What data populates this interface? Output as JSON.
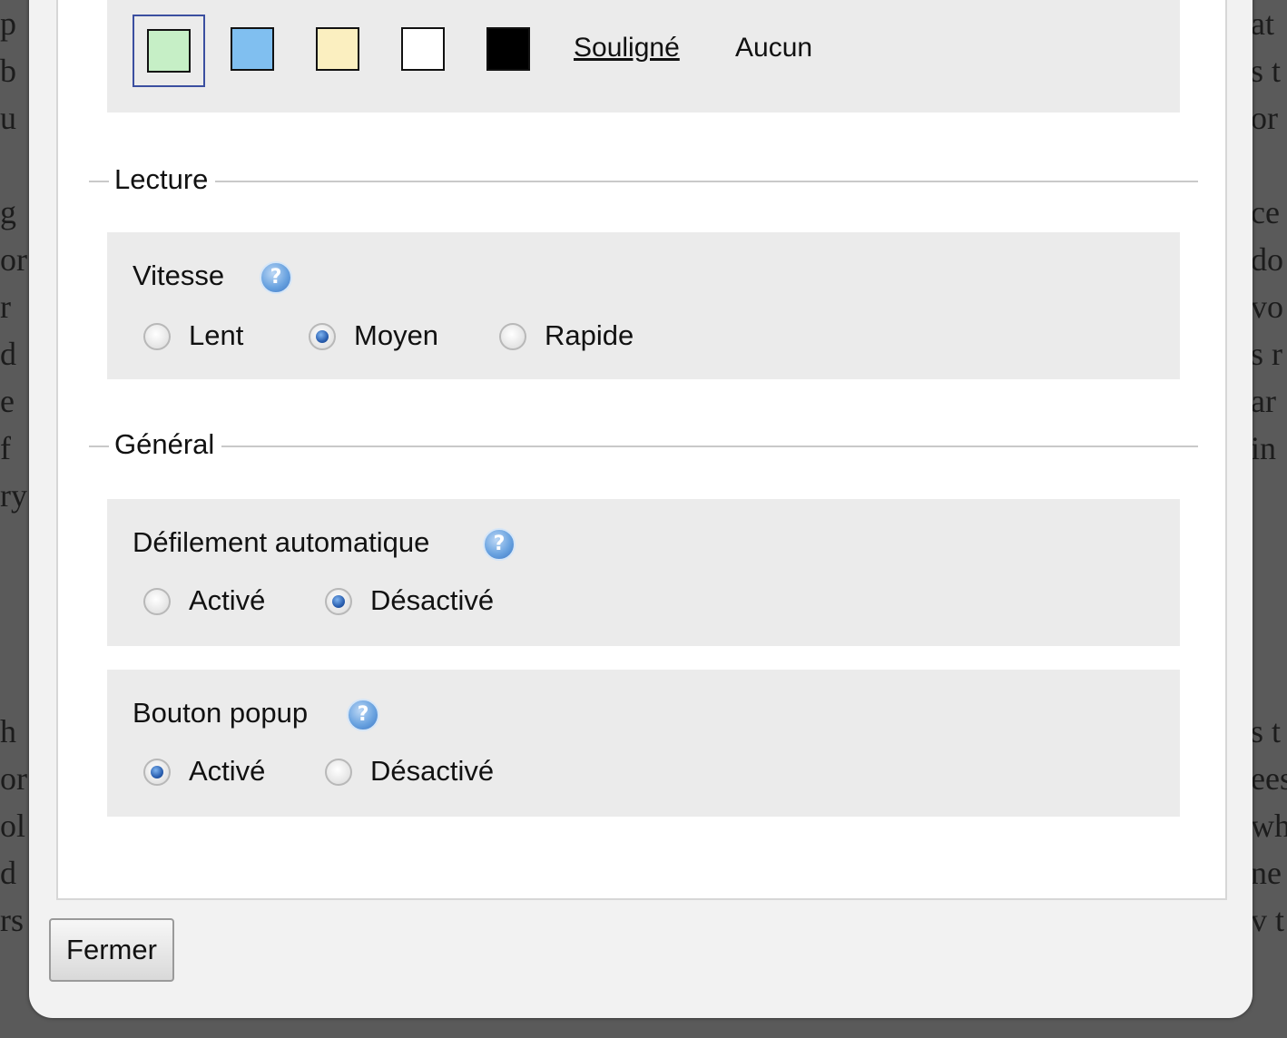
{
  "background_text": {
    "left": [
      "p",
      "b",
      "u",
      "",
      "g",
      "or",
      "r",
      "d",
      "e",
      "f",
      "ry",
      "",
      "",
      "",
      "",
      "h",
      "or",
      "ol",
      "d",
      "rs"
    ],
    "right": [
      "at",
      "s t",
      "or",
      "",
      "ce",
      "do",
      "vo",
      "s r",
      "ar",
      "in",
      "",
      "",
      "",
      "",
      "",
      "s t",
      "ees",
      "wh",
      "ne",
      "v t"
    ]
  },
  "highlight": {
    "swatches": [
      {
        "name": "green",
        "color": "#c6efc6",
        "selected": true
      },
      {
        "name": "blue",
        "color": "#80bff0",
        "selected": false
      },
      {
        "name": "yellow",
        "color": "#fbefc0",
        "selected": false
      },
      {
        "name": "white",
        "color": "#ffffff",
        "selected": false
      },
      {
        "name": "black",
        "color": "#000000",
        "selected": false
      }
    ],
    "underline_label": "Souligné",
    "none_label": "Aucun"
  },
  "sections": {
    "reading": {
      "legend": "Lecture",
      "speed": {
        "title": "Vitesse",
        "options": [
          {
            "label": "Lent",
            "checked": false
          },
          {
            "label": "Moyen",
            "checked": true
          },
          {
            "label": "Rapide",
            "checked": false
          }
        ]
      }
    },
    "general": {
      "legend": "Général",
      "autoscroll": {
        "title": "Défilement automatique",
        "options": [
          {
            "label": "Activé",
            "checked": false
          },
          {
            "label": "Désactivé",
            "checked": true
          }
        ]
      },
      "popup": {
        "title": "Bouton popup",
        "options": [
          {
            "label": "Activé",
            "checked": true
          },
          {
            "label": "Désactivé",
            "checked": false
          }
        ]
      }
    }
  },
  "help_icon_glyph": "?",
  "footer": {
    "close_label": "Fermer"
  }
}
